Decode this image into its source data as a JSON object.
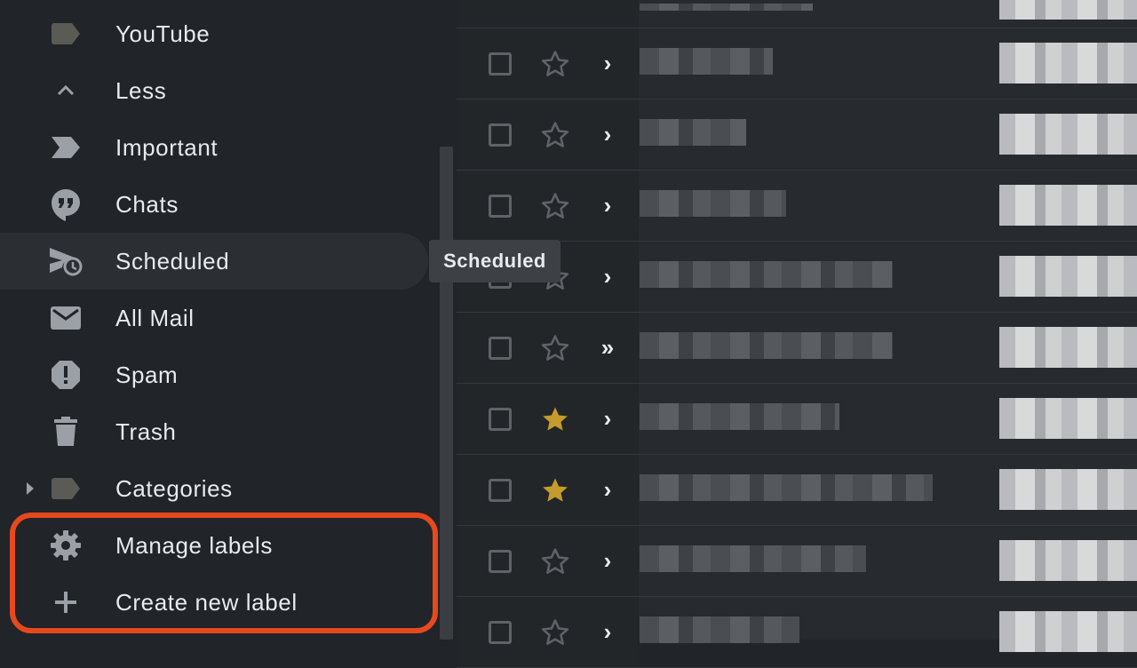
{
  "sidebar": {
    "items": [
      {
        "label": "YouTube",
        "icon": "label-icon"
      },
      {
        "label": "Less",
        "icon": "chevron-up-icon"
      },
      {
        "label": "Important",
        "icon": "important-icon"
      },
      {
        "label": "Chats",
        "icon": "chat-icon"
      },
      {
        "label": "Scheduled",
        "icon": "scheduled-send-icon"
      },
      {
        "label": "All Mail",
        "icon": "mail-icon"
      },
      {
        "label": "Spam",
        "icon": "spam-icon"
      },
      {
        "label": "Trash",
        "icon": "trash-icon"
      },
      {
        "label": "Categories",
        "icon": "label-icon"
      },
      {
        "label": "Manage labels",
        "icon": "gear-icon"
      },
      {
        "label": "Create new label",
        "icon": "plus-icon"
      }
    ],
    "tooltip": "Scheduled"
  },
  "mail_list": {
    "rows": [
      {
        "starred": false,
        "importance": "›"
      },
      {
        "starred": false,
        "importance": "›"
      },
      {
        "starred": false,
        "importance": "›"
      },
      {
        "starred": false,
        "importance": "›"
      },
      {
        "starred": false,
        "importance": "»"
      },
      {
        "starred": true,
        "importance": "›"
      },
      {
        "starred": true,
        "importance": "›"
      },
      {
        "starred": false,
        "importance": "›"
      },
      {
        "starred": false,
        "importance": "›"
      }
    ]
  },
  "colors": {
    "background": "#212428",
    "highlight": "#e6491e",
    "star_gold": "#c49b2c",
    "text": "#e8eaed"
  }
}
